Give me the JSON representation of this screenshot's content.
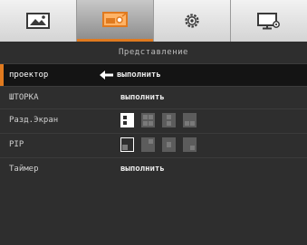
{
  "tabs": [
    {
      "name": "image-icon",
      "active": false
    },
    {
      "name": "projector-icon",
      "active": true
    },
    {
      "name": "gear-icon",
      "active": false
    },
    {
      "name": "monitor-settings-icon",
      "active": false
    }
  ],
  "section_title": "Представление",
  "menu": {
    "items": [
      {
        "label": "проектор",
        "value": "выполнить",
        "selected": true
      },
      {
        "label": "ШТОРКА",
        "value": "выполнить",
        "selected": false
      },
      {
        "label": "Разд.Экран",
        "value": "",
        "selected": false
      },
      {
        "label": "PIP",
        "value": "",
        "selected": false
      },
      {
        "label": "Таймер",
        "value": "выполнить",
        "selected": false
      }
    ]
  },
  "icons": {
    "enter": "enter-arrow-icon",
    "split_options": [
      "split-full-left-icon",
      "split-quad-icon",
      "split-vertical-icon",
      "split-bottom-icon"
    ],
    "pip_options": [
      "pip-bottom-left-icon",
      "pip-top-right-icon",
      "pip-center-icon",
      "pip-bottom-right-icon"
    ]
  },
  "colors": {
    "accent": "#e07a1f",
    "background": "#2e2e2e",
    "selected_row": "#141414"
  }
}
